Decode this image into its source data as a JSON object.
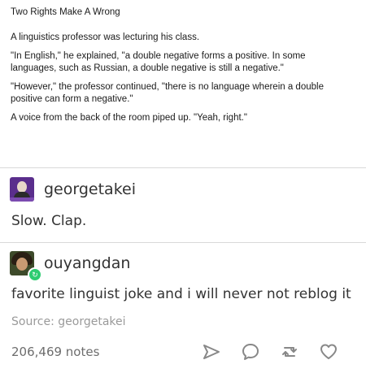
{
  "quote": {
    "title": "Two Rights Make A Wrong",
    "paragraphs": [
      "A linguistics professor was lecturing his class.",
      "\"In English,\" he explained, \"a double negative forms a positive.  In some languages, such as Russian, a double negative is still a negative.\"",
      "\"However,\" the professor continued, \"there is no language wherein a double positive can form a negative.\"",
      "A voice from the back of the room piped up.  \"Yeah, right.\""
    ]
  },
  "posts": [
    {
      "username": "georgetakei",
      "text": "Slow. Clap."
    },
    {
      "username": "ouyangdan",
      "text": "favorite linguist joke and i will never not reblog it"
    }
  ],
  "source": "Source: georgetakei",
  "notes": "206,469 notes",
  "icons": {
    "share": "share-icon",
    "reply": "reply-icon",
    "reblog": "reblog-icon",
    "like": "heart-icon"
  },
  "colors": {
    "avatar_purple": "#5a2e8c",
    "reblog_green": "#2ecc71"
  }
}
